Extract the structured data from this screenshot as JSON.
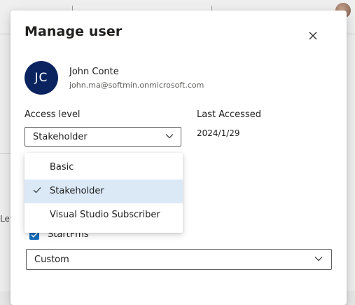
{
  "modal": {
    "title": "Manage user"
  },
  "user": {
    "initials": "JC",
    "name": "John Conte",
    "email": "john.ma@softmin.onmicrosoft.com"
  },
  "access": {
    "label": "Access level",
    "selected": "Stakeholder",
    "options": [
      "Basic",
      "Stakeholder",
      "Visual Studio Subscriber"
    ]
  },
  "last_accessed": {
    "label": "Last Accessed",
    "value": "2024/1/29"
  },
  "group": {
    "label": "StartFms",
    "checked": true
  },
  "role_select": {
    "value": "Custom"
  },
  "background": {
    "partial_text": "Lev"
  },
  "colors": {
    "avatar": "#0b2460",
    "accent": "#0f6cbd",
    "selected_bg": "#dbe9f7"
  },
  "icons": {
    "close": "close-icon",
    "chevron": "chevron-down-icon",
    "check": "checkmark-icon"
  }
}
